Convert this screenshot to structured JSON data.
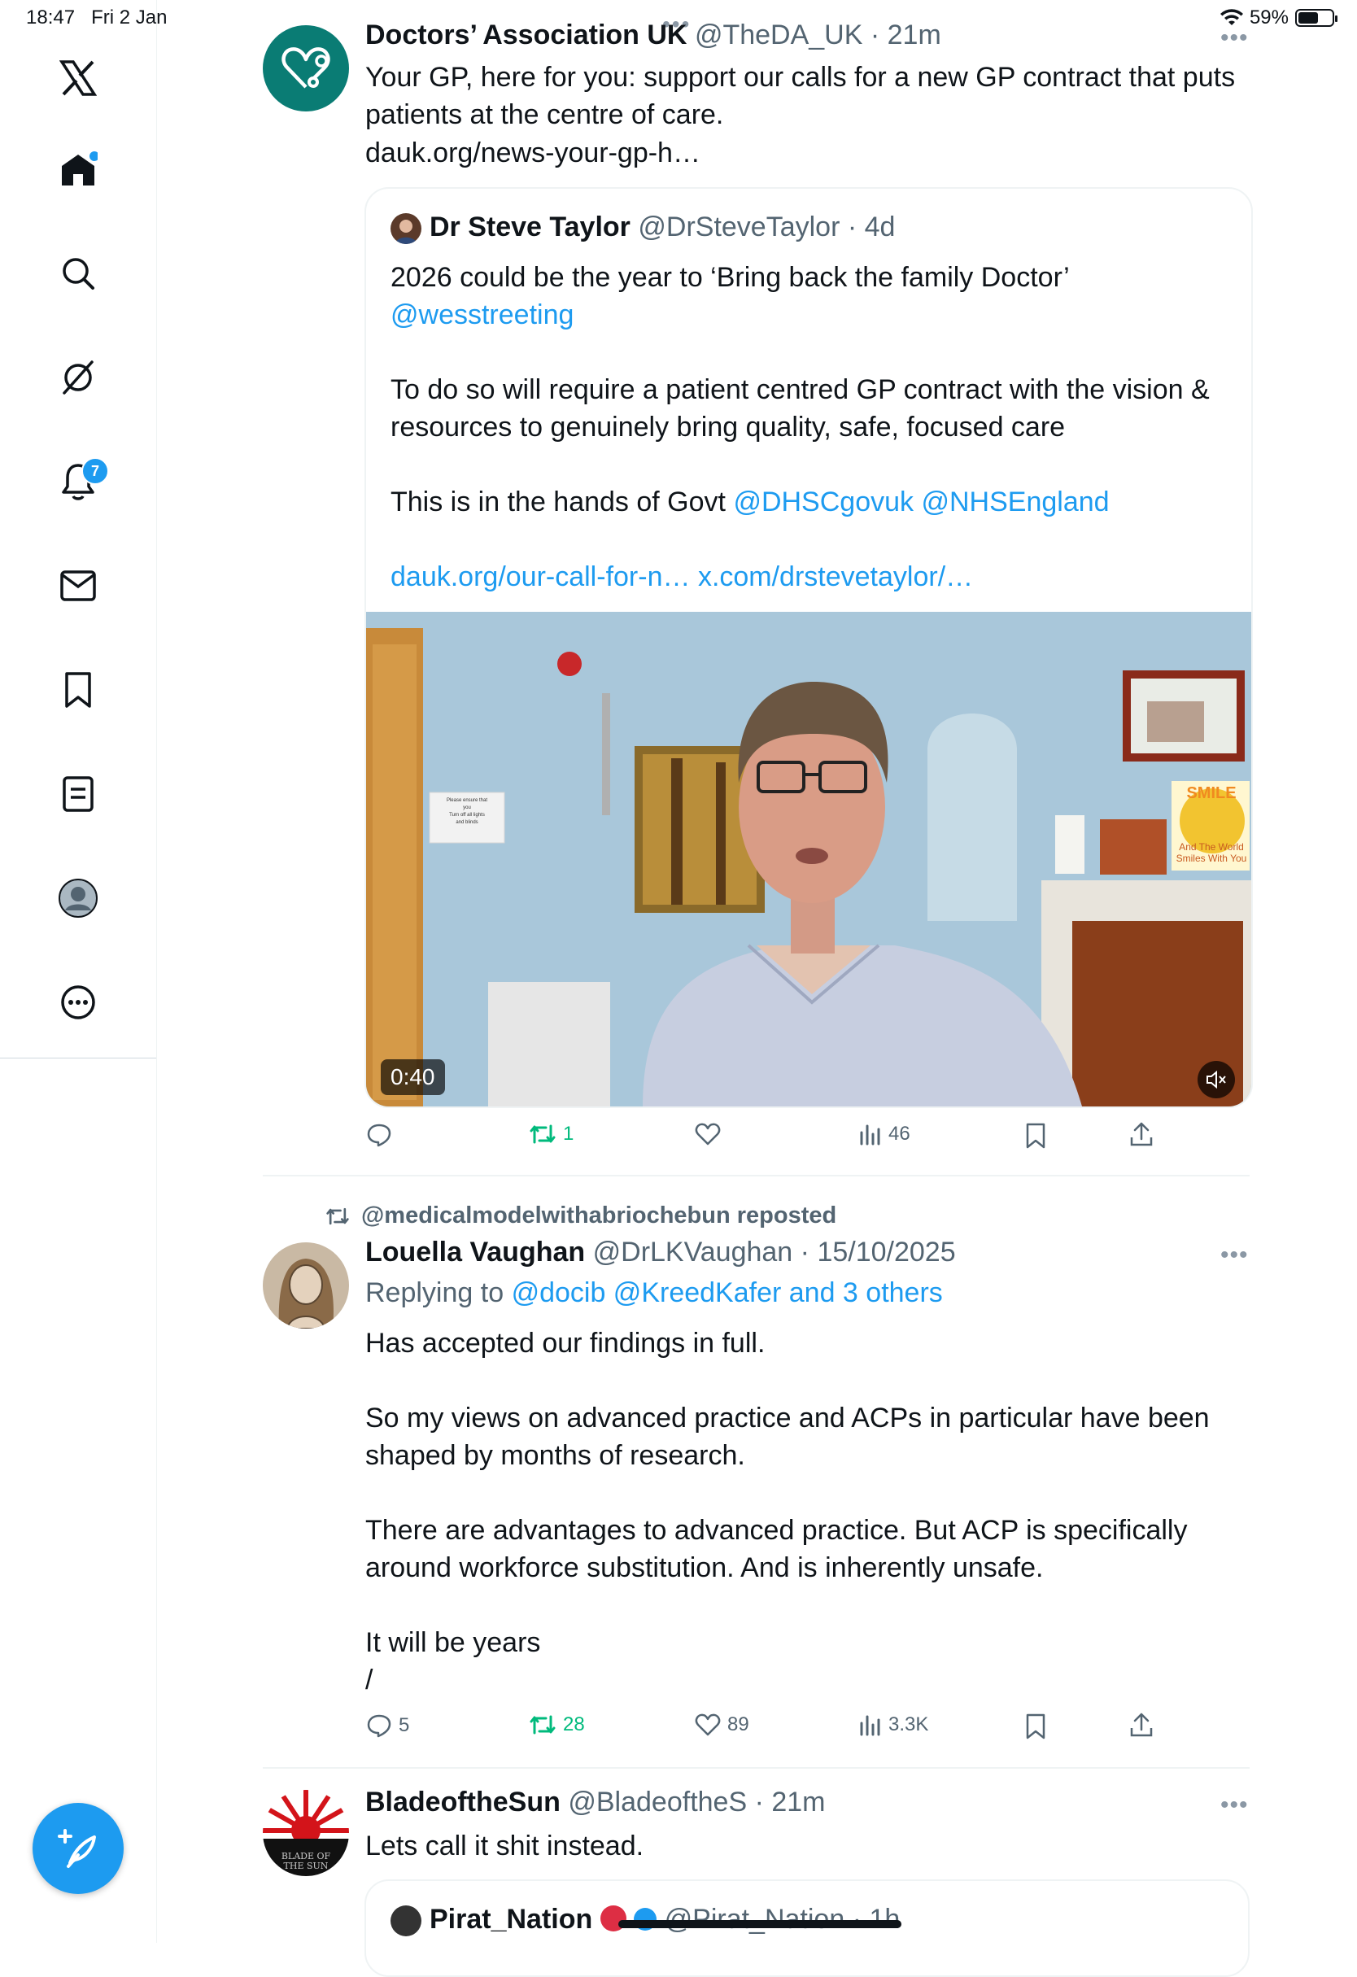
{
  "status_bar": {
    "time": "18:47",
    "date": "Fri 2 Jan",
    "battery": "59%"
  },
  "sidebar": {
    "notification_count": "7"
  },
  "tweet1": {
    "name": "Doctors’ Association UK",
    "handle": "@TheDA_UK",
    "time": "21m",
    "text": "Your GP, here for you: support our calls for a new GP contract that puts patients at the centre of care.",
    "link": "dauk.org/news-your-gp-h…",
    "quote": {
      "name": "Dr Steve Taylor",
      "handle": "@DrSteveTaylor",
      "time": "4d",
      "line1": "2026 could be the year to ‘Bring back the family Doctor’",
      "mention1": "@wesstreeting",
      "para2": "To do so will require a patient centred GP contract with the vision & resources to genuinely bring quality, safe, focused care",
      "para3_prefix": "This is in the hands of Govt",
      "mention2": "@DHSCgovuk",
      "mention3": "@NHSEngland",
      "link1": "dauk.org/our-call-for-n…",
      "link2": "x.com/drstevetaylor/…",
      "video_duration": "0:40",
      "video_sign_lines": [
        "Please ensure that",
        "you",
        "Turn off all lights",
        "and blinds"
      ],
      "video_sign_top": "SMILE",
      "video_sign_bottom": "And The World Smiles With You"
    },
    "actions": {
      "replies": "",
      "reposts": "1",
      "likes": "",
      "views": "46"
    }
  },
  "tweet2": {
    "reposted_by": "@medicalmodelwithabriochebun reposted",
    "name": "Louella Vaughan",
    "handle": "@DrLKVaughan",
    "time": "15/10/2025",
    "replying_prefix": "Replying to",
    "replying_to": "@docib @KreedKafer and 3 others",
    "para1": "Has accepted our findings in full.",
    "para2": "So my views on advanced practice and ACPs in particular have been shaped by months of research.",
    "para3": "There are advantages to advanced practice. But ACP is specifically around workforce substitution. And is inherently unsafe.",
    "para4": "It will be years",
    "para5": "/",
    "actions": {
      "replies": "5",
      "reposts": "28",
      "likes": "89",
      "views": "3.3K"
    }
  },
  "tweet3": {
    "name": "BladeoftheSun",
    "handle": "@BladeoftheS",
    "time": "21m",
    "text": "Lets call it shit instead.",
    "avatar_text": "BLADE OF THE SUN",
    "quote": {
      "name": "Pirat_Nation",
      "handle": "@Pirat_Nation",
      "time": "1h"
    }
  }
}
